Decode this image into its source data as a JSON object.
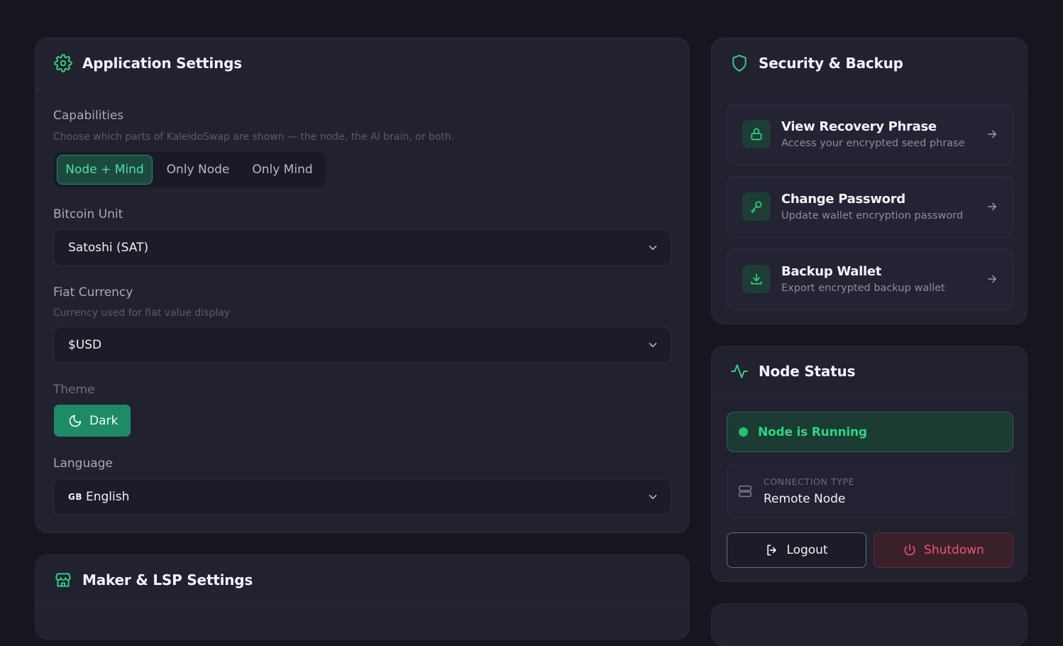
{
  "app_settings": {
    "title": "Application Settings",
    "capabilities": {
      "label": "Capabilities",
      "description": "Choose which parts of KaleidoSwap are shown — the node, the AI brain, or both.",
      "options": [
        "Node + Mind",
        "Only Node",
        "Only Mind"
      ],
      "selected": "Node + Mind"
    },
    "bitcoin_unit": {
      "label": "Bitcoin Unit",
      "value": "Satoshi (SAT)"
    },
    "fiat_currency": {
      "label": "Fiat Currency",
      "description": "Currency used for fiat value display",
      "value": "$USD"
    },
    "theme": {
      "label": "Theme",
      "value": "Dark"
    },
    "language": {
      "label": "Language",
      "code": "GB",
      "value": "English"
    }
  },
  "maker_settings": {
    "title": "Maker & LSP Settings"
  },
  "security": {
    "title": "Security & Backup",
    "items": [
      {
        "title": "View Recovery Phrase",
        "subtitle": "Access your encrypted seed phrase",
        "icon": "lock-icon"
      },
      {
        "title": "Change Password",
        "subtitle": "Update wallet encryption password",
        "icon": "key-icon"
      },
      {
        "title": "Backup Wallet",
        "subtitle": "Export encrypted backup wallet",
        "icon": "download-icon"
      }
    ]
  },
  "node_status": {
    "title": "Node Status",
    "status_text": "Node is Running",
    "connection_label": "CONNECTION TYPE",
    "connection_value": "Remote Node",
    "logout_label": "Logout",
    "shutdown_label": "Shutdown"
  },
  "colors": {
    "accent": "#2fd67c",
    "background": "#16161f",
    "card": "#212130",
    "danger": "#f0546b"
  }
}
